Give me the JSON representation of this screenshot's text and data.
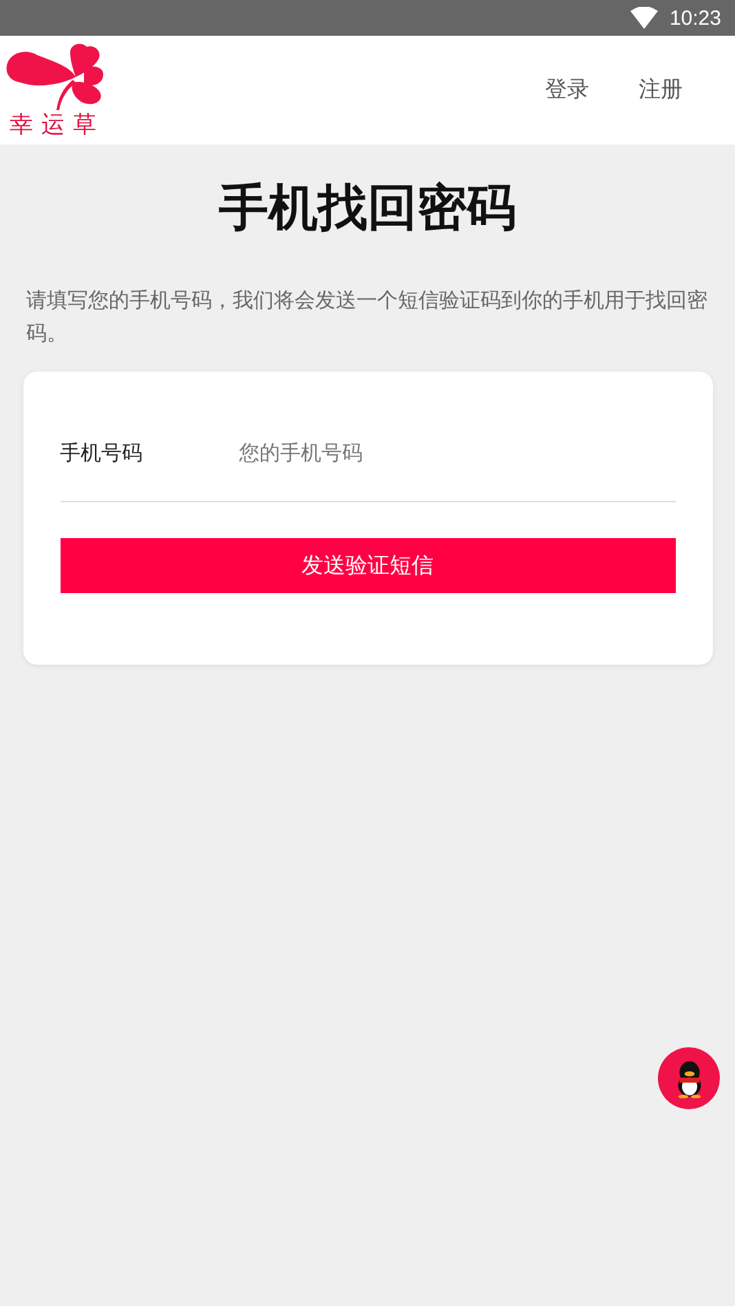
{
  "status_bar": {
    "time": "10:23"
  },
  "header": {
    "logo_text": "幸运草",
    "links": [
      "登录",
      "注册"
    ]
  },
  "title": "手机找回密码",
  "description": "请填写您的手机号码，我们将会发送一个短信验证码到你的手机用于找回密码。",
  "form": {
    "phone_label": "手机号码",
    "phone_placeholder": "您的手机号码",
    "submit": "发送验证短信"
  }
}
